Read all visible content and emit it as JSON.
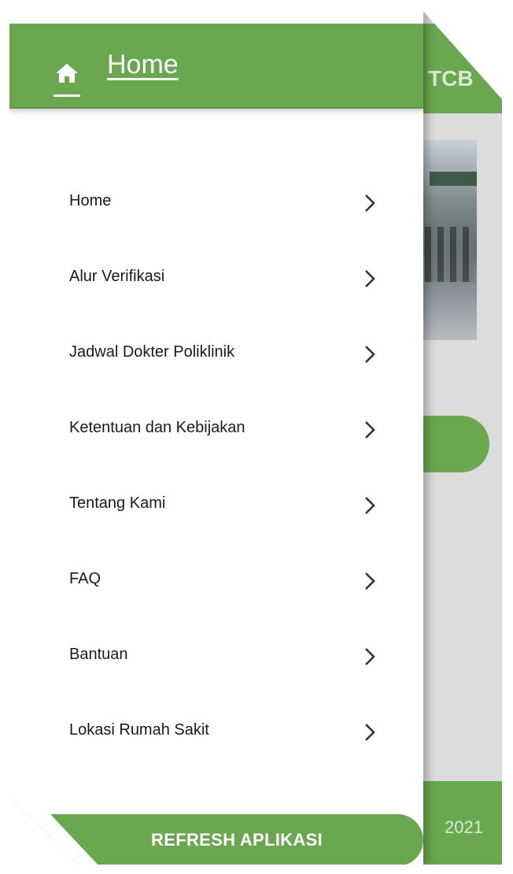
{
  "background": {
    "header_text": "TCB",
    "footer_text": "2021"
  },
  "drawer": {
    "title": "Home",
    "menu": [
      {
        "label": "Home"
      },
      {
        "label": "Alur Verifikasi"
      },
      {
        "label": "Jadwal Dokter Poliklinik"
      },
      {
        "label": "Ketentuan dan Kebijakan"
      },
      {
        "label": "Tentang Kami"
      },
      {
        "label": "FAQ"
      },
      {
        "label": "Bantuan"
      },
      {
        "label": "Lokasi Rumah Sakit"
      }
    ],
    "refresh_label": "REFRESH APLIKASI"
  },
  "colors": {
    "primary_green": "#6aa84f",
    "text": "#1a1a1a"
  },
  "icons": {
    "header": "home-icon",
    "menu_item": "chevron-right-icon"
  }
}
